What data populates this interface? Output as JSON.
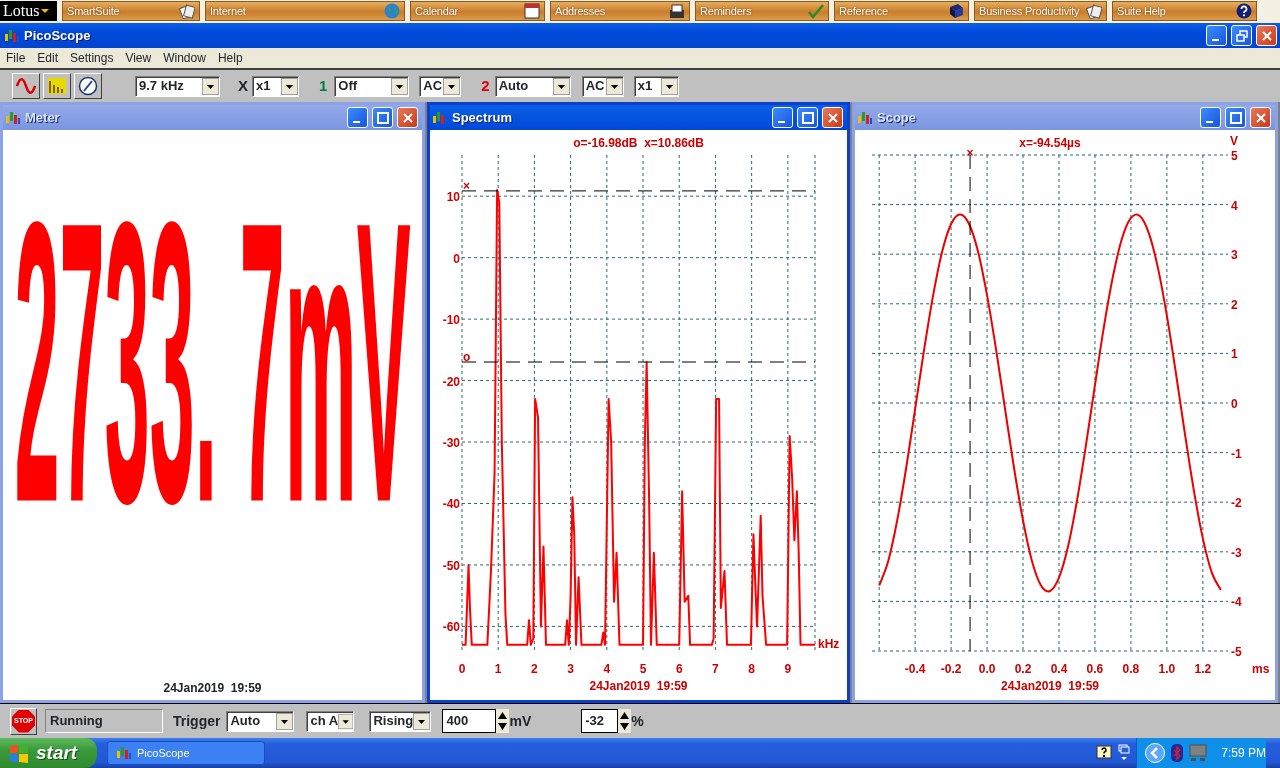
{
  "suite_bar": {
    "menu": "Lotus",
    "items": [
      "SmartSuite",
      "Internet",
      "Calendar",
      "Addresses",
      "Reminders",
      "Reference",
      "Business Productivity",
      "Suite Help"
    ]
  },
  "window": {
    "title": "PicoScope"
  },
  "menu": [
    "File",
    "Edit",
    "Settings",
    "View",
    "Window",
    "Help"
  ],
  "toolbar": [
    {
      "kind": "select",
      "value": "9.7 kHz"
    },
    {
      "kind": "label",
      "text": "X"
    },
    {
      "kind": "select",
      "value": "x1"
    },
    {
      "kind": "label",
      "text": "1",
      "color": "#008040"
    },
    {
      "kind": "select",
      "value": "Off"
    },
    {
      "kind": "select",
      "value": "AC"
    },
    {
      "kind": "label",
      "text": "2",
      "color": "#e00000"
    },
    {
      "kind": "select",
      "value": "Auto"
    },
    {
      "kind": "select",
      "value": "AC"
    },
    {
      "kind": "select",
      "value": "x1"
    }
  ],
  "panes": [
    {
      "kind": "meter",
      "title": "Meter",
      "active": false,
      "reading": "2733. 7mV",
      "timestamp": "24Jan2019  19:59"
    },
    {
      "kind": "spectrum",
      "title": "Spectrum",
      "active": true,
      "readout": "o=-16.98dB  x=10.86dB",
      "timestamp": "24Jan2019  19:59",
      "chart_data": {
        "type": "line",
        "xlabel": "kHz",
        "xlim": [
          0,
          9.75
        ],
        "ylim": [
          -64,
          16.7
        ],
        "xticks": [
          0,
          1,
          2,
          3,
          4,
          5,
          6,
          7,
          8,
          9
        ],
        "yticks": [
          10,
          0,
          -10,
          -20,
          -30,
          -40,
          -50,
          -60
        ],
        "x": [
          0,
          0.1,
          0.18,
          0.22,
          0.27,
          0.7,
          0.8,
          0.9,
          0.97,
          1.03,
          1.1,
          1.2,
          1.25,
          1.8,
          1.85,
          1.9,
          1.97,
          2.02,
          2.1,
          2.18,
          2.25,
          2.32,
          2.85,
          2.9,
          2.95,
          3.0,
          3.05,
          3.1,
          3.15,
          3.22,
          3.3,
          3.85,
          3.9,
          3.95,
          4.05,
          4.12,
          4.2,
          4.27,
          4.35,
          5.0,
          5.05,
          5.1,
          5.17,
          5.22,
          5.3,
          5.38,
          6.0,
          6.08,
          6.15,
          6.25,
          6.3,
          6.9,
          6.95,
          7.02,
          7.1,
          7.15,
          7.25,
          7.32,
          7.98,
          8.05,
          8.1,
          8.15,
          8.25,
          8.3,
          8.4,
          8.98,
          9.05,
          9.12,
          9.18,
          9.25,
          9.3,
          9.35,
          9.75
        ],
        "series": [
          {
            "color": "#ff0000",
            "values": [
              -63,
              -63,
              -50,
              -57,
              -63,
              -63,
              -51,
              -35,
              11,
              9,
              -30,
              -58,
              -63,
              -63,
              -59,
              -63,
              -62,
              -23,
              -26,
              -60,
              -47,
              -63,
              -63,
              -59,
              -63,
              -55,
              -39,
              -45,
              -63,
              -52,
              -63,
              -63,
              -61,
              -63,
              -23,
              -30,
              -56,
              -48,
              -63,
              -63,
              -30,
              -17,
              -40,
              -63,
              -48,
              -63,
              -63,
              -38,
              -56,
              -55,
              -63,
              -63,
              -62,
              -23,
              -23,
              -57,
              -51,
              -63,
              -63,
              -45,
              -53,
              -60,
              -42,
              -55,
              -63,
              -63,
              -29,
              -36,
              -46,
              -38,
              -48,
              -63,
              -63
            ]
          }
        ],
        "grid": true,
        "ref_lines": [
          {
            "axis": "y",
            "value": 10.86,
            "label": "×"
          },
          {
            "axis": "y",
            "value": -16.98,
            "label": "o"
          }
        ]
      }
    },
    {
      "kind": "scope",
      "title": "Scope",
      "active": false,
      "readout": "x=-94.54µs",
      "timestamp": "24Jan2019  19:59",
      "chart_data": {
        "type": "line",
        "xlabel": "ms",
        "ylabel": "V",
        "xlim": [
          -0.64,
          1.34
        ],
        "ylim": [
          -5,
          5
        ],
        "xticks": [
          {
            "value": -0.4,
            "label": "-0.4"
          },
          {
            "value": -0.2,
            "label": "-0.2"
          },
          {
            "value": 0,
            "label": "0.0"
          },
          {
            "value": 0.2,
            "label": "0.2"
          },
          {
            "value": 0.4,
            "label": "0.4"
          },
          {
            "value": 0.6,
            "label": "0.6"
          },
          {
            "value": 0.8,
            "label": "0.8"
          },
          {
            "value": 1.0,
            "label": "1.0"
          },
          {
            "value": 1.2,
            "label": "1.2"
          }
        ],
        "yticks": [
          5,
          4,
          3,
          2,
          1,
          0,
          -1,
          -2,
          -3,
          -4,
          -5
        ],
        "x": [
          -0.6,
          -0.55,
          -0.5,
          -0.45,
          -0.4,
          -0.35,
          -0.3,
          -0.25,
          -0.2,
          -0.15,
          -0.1,
          -0.05,
          0,
          0.05,
          0.1,
          0.15,
          0.2,
          0.25,
          0.3,
          0.35,
          0.4,
          0.45,
          0.5,
          0.55,
          0.6,
          0.65,
          0.7,
          0.75,
          0.8,
          0.85,
          0.9,
          0.95,
          1.0,
          1.05,
          1.1,
          1.15,
          1.2,
          1.25,
          1.3
        ],
        "series": [
          {
            "color": "#ee0000",
            "values": [
              -3.68,
              -3.19,
              -2.37,
              -1.31,
              -0.12,
              1.08,
              2.17,
              3.05,
              3.61,
              3.8,
              3.61,
              3.05,
              2.17,
              1.08,
              -0.12,
              -1.31,
              -2.37,
              -3.19,
              -3.68,
              -3.79,
              -3.52,
              -2.9,
              -1.97,
              -0.85,
              0.36,
              1.54,
              2.55,
              3.31,
              3.73,
              3.77,
              3.42,
              2.73,
              1.76,
              0.61,
              -0.61,
              -1.76,
              -2.73,
              -3.42,
              -3.77
            ]
          }
        ],
        "grid": true,
        "ref_lines": [
          {
            "axis": "x",
            "value": -0.09454,
            "label": "×"
          }
        ]
      }
    }
  ],
  "status_bar": {
    "stop": "STOP",
    "state": "Running",
    "trigger_label": "Trigger",
    "controls": [
      {
        "kind": "select",
        "value": "Auto"
      },
      {
        "kind": "select",
        "value": "ch A"
      },
      {
        "kind": "select",
        "value": "Rising"
      },
      {
        "kind": "spin",
        "value": "400",
        "unit": "mV"
      },
      {
        "kind": "spin",
        "value": "-32",
        "unit": "%"
      }
    ]
  },
  "taskbar": {
    "start": "start",
    "tasks": [
      {
        "label": "PicoScope",
        "selected": false
      }
    ],
    "clock": "7:59 PM"
  }
}
